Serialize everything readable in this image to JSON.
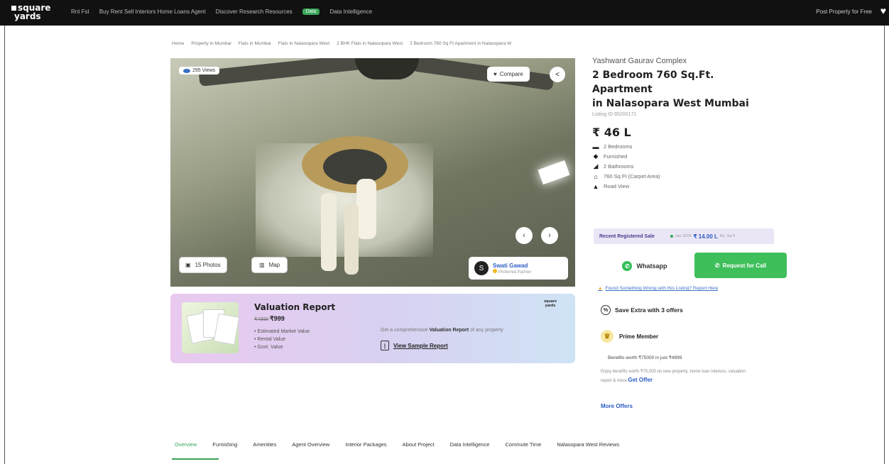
{
  "header": {
    "logo_line1": "square",
    "logo_line2": "yards",
    "nav": [
      "Rnt Fst",
      "Buy  Rent  Sell  Interiors  Home Loans  Agent",
      "Discover  Research  Resources",
      "Data Intelligence"
    ],
    "new_badge": "Data",
    "post_property": "Post Property for Free",
    "heart_icon": "heart-icon"
  },
  "breadcrumb": [
    "Home",
    "Property in Mumbai",
    "Flats in Mumbai",
    "Flats in Nalasopara West",
    "2 BHK Flats in Nalasopara West",
    "2 Bedroom 760 Sq Ft Apartment in Nalasopara W"
  ],
  "gallery": {
    "views": "295 Views",
    "compare": "Compare",
    "photos": "15 Photos",
    "map": "Map",
    "agent_initial": "S",
    "agent_name": "Swati Gawad",
    "agent_role": "Preferred Partner"
  },
  "valuation": {
    "title": "Valuation Report",
    "old_price": "₹4999",
    "price": "₹999",
    "points": [
      "Estimated Market Value",
      "Rental Value",
      "Govt. Value"
    ],
    "brand": "square yards",
    "desc_pre": "Get a comprehensive",
    "desc_bold": "Valuation Report",
    "desc_post": "of any property",
    "link": "View Sample Report"
  },
  "listing": {
    "project": "Yashwant Gaurav Complex",
    "title_line1": "2 Bedroom 760 Sq.Ft. Apartment",
    "title_line2": "in Nalasopara West Mumbai",
    "listing_id": "Listing ID 85200171",
    "price": "₹ 46 L",
    "features": [
      {
        "icon": "bed-icon",
        "glyph": "▬",
        "label": "2 Bedrooms"
      },
      {
        "icon": "sofa-icon",
        "glyph": "◆",
        "label": "Furnished"
      },
      {
        "icon": "bath-icon",
        "glyph": "◢",
        "label": "2 Bathrooms"
      },
      {
        "icon": "home-icon",
        "glyph": "⌂",
        "label": "760 Sq Ft (Carpet Area)"
      },
      {
        "icon": "road-icon",
        "glyph": "▲",
        "label": "Road View"
      }
    ]
  },
  "sale": {
    "label": "Recent Registered Sale",
    "date": "Jan 2024",
    "amount": "₹ 14.00 L",
    "psf": "Rs. Sq ft"
  },
  "actions": {
    "whatsapp": "Whatsapp",
    "call": "Request for Call",
    "report": "Found Something Wrong with this Listing? Report Here"
  },
  "offers": {
    "save": "Save Extra with 3 offers",
    "prime": "Prime Member",
    "benefits": "Benefits worth ₹75000 in just ₹4999",
    "enjoy": "Enjoy benefits worth ₹75,000 on new property, home loan interiors, valuation report & more",
    "get_offer": "Get Offer",
    "more": "More Offers"
  },
  "tabs": [
    "Overview",
    "Furnishing",
    "Amenities",
    "Agent Overview",
    "Interior Packages",
    "About Project",
    "Data Intelligence",
    "Commute Time",
    "Nalasopara West Reviews"
  ],
  "colors": {
    "accent_green": "#3fbf5a",
    "link_blue": "#2b5cc4",
    "header_bg": "#111111"
  }
}
